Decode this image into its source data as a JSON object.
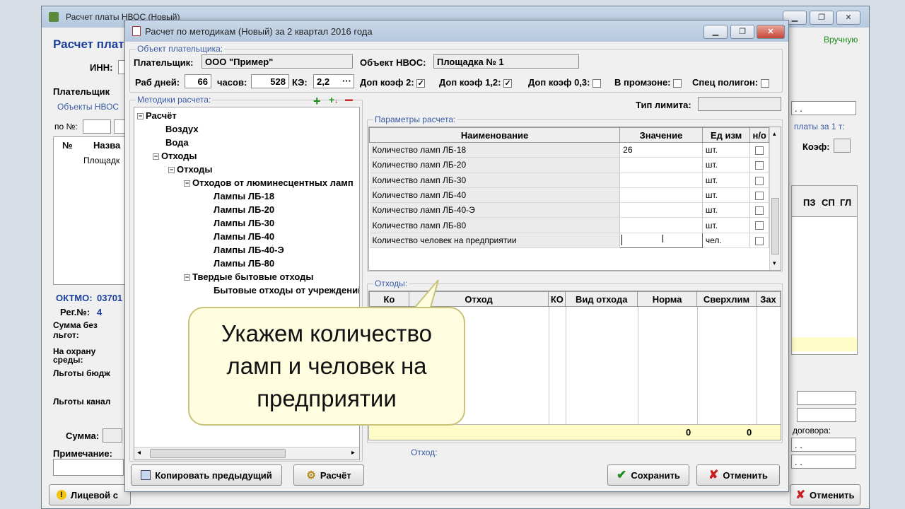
{
  "bg_window": {
    "title": "Расчет платы НВОС (Новый)",
    "header": "Расчет плат",
    "mode": "Вручную",
    "inn_label": "ИНН:",
    "tab_payer": "Плательщик",
    "objects_label": "Объекты НВОС",
    "no_label": "по №:",
    "table_headers": [
      "№",
      "Назва"
    ],
    "table_row": "Площадк",
    "oktmo_label": "ОКТМО:",
    "oktmo_value": "03701",
    "reg_label": "Рег.№:",
    "reg_value": "4",
    "sum_no_benefits": "Сумма без льгот:",
    "for_environment": "На охрану среды:",
    "benefits_budget": "Льготы бюдж",
    "benefits_channel": "Льготы канал",
    "sum_label": "Сумма:",
    "note_label": "Примечание:",
    "right_pay_label": "платы за 1 т:",
    "right_coef": "Коэф:",
    "right_cols": [
      "ПЗ",
      "СП",
      "ГЛ"
    ],
    "contract_label": "договора:",
    "date_placeholder": ". .",
    "personal_btn": "Лицевой с",
    "cancel_btn": "Отменить"
  },
  "dialog": {
    "title": "Расчет по методикам (Новый) за 2 квартал 2016 года",
    "payer_group": "Объект плательщика:",
    "payer_label": "Плательщик:",
    "payer_value": "ООО \"Пример\"",
    "object_label": "Объект НВОС:",
    "object_value": "Площадка № 1",
    "workdays_label": "Раб дней:",
    "workdays_value": "66",
    "hours_label": "часов:",
    "hours_value": "528",
    "ke_label": "КЭ:",
    "ke_value": "2,2",
    "ke_btn": "···",
    "coef2_label": "Доп коэф 2:",
    "coef12_label": "Доп коэф 1,2:",
    "coef03_label": "Доп коэф 0,3:",
    "promzone_label": "В промзоне:",
    "polygon_label": "Спец полигон:",
    "methods_group": "Методики расчета:",
    "limit_label": "Тип лимита:",
    "params_group": "Параметры расчета:",
    "waste_group": "Отходы:",
    "waste_label": "Отход:"
  },
  "tree": {
    "root": "Расчёт",
    "air": "Воздух",
    "water": "Вода",
    "waste": "Отходы",
    "waste_sub": "Отходы",
    "fluorescent": "Отходов от люминесцентных ламп",
    "lamps": [
      "Лампы ЛБ-18",
      "Лампы ЛБ-20",
      "Лампы ЛБ-30",
      "Лампы ЛБ-40",
      "Лампы ЛБ-40-Э",
      "Лампы ЛБ-80"
    ],
    "solid": "Твердые бытовые отходы",
    "household": "Бытовые отходы от учреждений"
  },
  "params": {
    "headers": [
      "Наименование",
      "Значение",
      "Ед изм",
      "н/о"
    ],
    "rows": [
      {
        "name": "Количество ламп ЛБ-18",
        "value": "26",
        "unit": "шт."
      },
      {
        "name": "Количество ламп ЛБ-20",
        "value": "",
        "unit": "шт."
      },
      {
        "name": "Количество ламп ЛБ-30",
        "value": "",
        "unit": "шт."
      },
      {
        "name": "Количество ламп ЛБ-40",
        "value": "",
        "unit": "шт."
      },
      {
        "name": "Количество ламп ЛБ-40-Э",
        "value": "",
        "unit": "шт."
      },
      {
        "name": "Количество ламп ЛБ-80",
        "value": "",
        "unit": "шт."
      },
      {
        "name": "Количество человек на предприятии",
        "value": "",
        "unit": "чел."
      }
    ]
  },
  "waste_table": {
    "headers": [
      "Ко",
      "Отход",
      "КО",
      "Вид отхода",
      "Норма",
      "Сверхлим",
      "Зах"
    ],
    "total_norm": "0",
    "total_over": "0"
  },
  "buttons": {
    "copy_prev": "Копировать предыдущий",
    "calc": "Расчёт",
    "save": "Сохранить",
    "cancel": "Отменить"
  },
  "callout": {
    "text": "Укажем количество ламп и человек на предприятии"
  },
  "colors": {
    "accent": "#1a3f9c",
    "save_green": "#1c8a1c",
    "cancel_red": "#c81e1e"
  }
}
